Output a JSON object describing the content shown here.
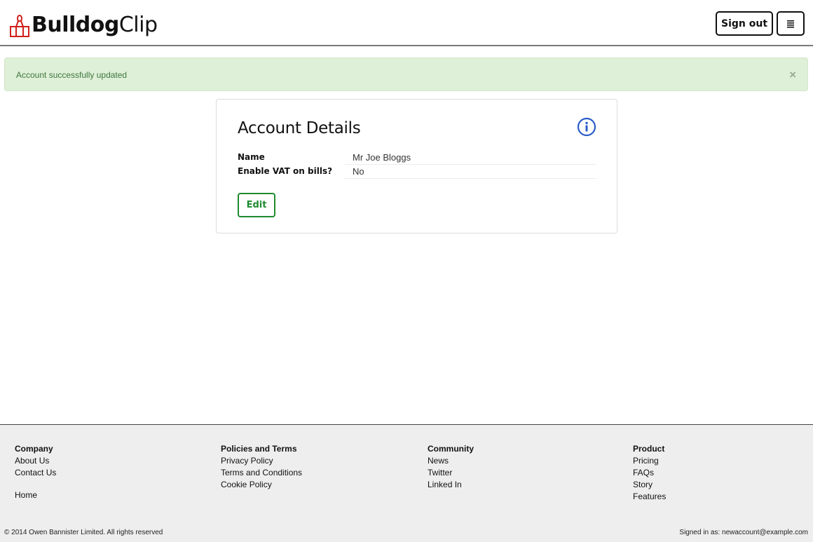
{
  "header": {
    "brand_bold": "Bulldog",
    "brand_light": "Clip",
    "logo_icon": "bulldog-clip-icon",
    "signout_label": "Sign out",
    "menu_icon": "hamburger-menu-icon"
  },
  "alert": {
    "message": "Account successfully updated",
    "close_label": "×"
  },
  "account": {
    "title": "Account Details",
    "info_icon": "info-icon",
    "fields": [
      {
        "label": "Name",
        "value": "Mr Joe Bloggs"
      },
      {
        "label": "Enable VAT on bills?",
        "value": "No"
      }
    ],
    "edit_label": "Edit"
  },
  "footer": {
    "columns": [
      {
        "heading": "Company",
        "links": [
          "About Us",
          "Contact Us"
        ],
        "extra": "Home"
      },
      {
        "heading": "Policies and Terms",
        "links": [
          "Privacy Policy",
          "Terms and Conditions",
          "Cookie Policy"
        ]
      },
      {
        "heading": "Community",
        "links": [
          "News",
          "Twitter",
          "Linked In"
        ]
      },
      {
        "heading": "Product",
        "links": [
          "Pricing",
          "FAQs",
          "Story",
          "Features"
        ]
      }
    ],
    "copyright": "© 2014 Owen Bannister Limited. All rights reserved",
    "signed_in": "Signed in as: newaccount@example.com"
  },
  "colors": {
    "brand_red": "#d0201a",
    "success_bg": "#dff0d8",
    "success_text": "#3c763d",
    "edit_green": "#1e8a2e",
    "info_blue": "#2a5cc8"
  }
}
